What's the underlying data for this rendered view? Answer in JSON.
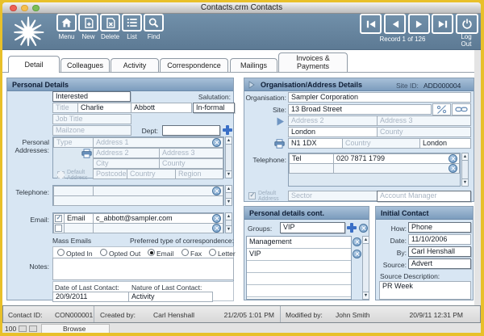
{
  "window": {
    "title": "Contacts.crm Contacts"
  },
  "toolbar": {
    "buttons": [
      "Menu",
      "New",
      "Delete",
      "List",
      "Find"
    ],
    "record_status": "Record 1 of 126",
    "logout": "Log Out"
  },
  "tabs": {
    "items": [
      "Detail",
      "Colleagues",
      "Activity",
      "Correspondence",
      "Mailings",
      "Invoices & Payments"
    ],
    "active": "Detail"
  },
  "personal": {
    "title": "Personal Details",
    "interested": "Interested",
    "salutation_label": "Salutation:",
    "salutation": "In-formal",
    "title_ph": "Title",
    "first_name": "Charlie",
    "last_name": "Abbott",
    "job_title_ph": "Job Title",
    "mailzone_ph": "Mailzone",
    "dept_label": "Dept:",
    "addresses_label": "Personal Addresses:",
    "addr": {
      "type_ph": "Type",
      "a1_ph": "Address 1",
      "a2_ph": "Address 2",
      "a3_ph": "Address 3",
      "city_ph": "City",
      "county_ph": "County",
      "postcode_ph": "Postcode",
      "country_ph": "Country",
      "region_ph": "Region",
      "default_label": "Default Address"
    },
    "telephone_label": "Telephone:",
    "email_label": "Email:",
    "email_type": "Email",
    "email_value": "c_abbott@sampler.com",
    "mass_emails_label": "Mass Emails",
    "opted_in": "Opted In",
    "opted_out": "Opted Out",
    "preferred_label": "Preferred type of correspondence:",
    "pref_email": "Email",
    "pref_fax": "Fax",
    "pref_letter": "Letter",
    "preferred_selected": "Email",
    "notes_label": "Notes:",
    "date_last_label": "Date of Last Contact:",
    "date_last": "20/9/2011",
    "nature_last_label": "Nature of Last Contact:",
    "nature_last": "Activity"
  },
  "org": {
    "title": "Organisation/Address Details",
    "site_id_label": "Site ID:",
    "site_id": "ADD000004",
    "organisation_label": "Organisation:",
    "organisation": "Sampler Corporation",
    "site_label": "Site:",
    "address1": "13 Broad Street",
    "a2_ph": "Address 2",
    "a3_ph": "Address 3",
    "city": "London",
    "county_ph": "County",
    "postcode": "N1 1DX",
    "country_ph": "Country",
    "region": "London",
    "telephone_label": "Telephone:",
    "phone_type": "Tel",
    "phone_number": "020 7871 1799",
    "default_label": "Default Address",
    "sector_ph": "Sector",
    "account_manager_ph": "Account Manager"
  },
  "cont": {
    "title": "Personal details cont.",
    "groups_label": "Groups:",
    "groups_value": "VIP",
    "items": [
      "Management",
      "VIP"
    ]
  },
  "initial": {
    "title": "Initial Contact",
    "how_label": "How:",
    "how": "Phone",
    "date_label": "Date:",
    "date": "11/10/2006",
    "by_label": "By:",
    "by": "Carl Henshall",
    "source_label": "Source:",
    "source": "Advert",
    "source_desc_label": "Source Description:",
    "source_desc": "PR Week"
  },
  "status": {
    "contact_id_label": "Contact ID:",
    "contact_id": "CON000001",
    "created_by_label": "Created by:",
    "created_by": "Carl Henshall",
    "created_at": "21/2/05 1:01 PM",
    "modified_by_label": "Modified by:",
    "modified_by": "John Smith",
    "modified_at": "20/9/11 12:31 PM"
  },
  "bottom": {
    "zoom": "100",
    "mode": "Browse"
  }
}
